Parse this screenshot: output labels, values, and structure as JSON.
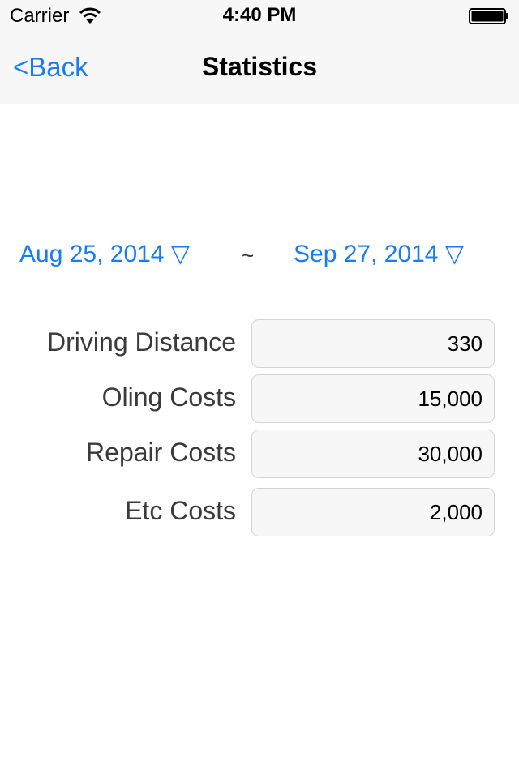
{
  "status_bar": {
    "carrier": "Carrier",
    "time": "4:40 PM",
    "wifi_icon": "wifi-icon",
    "battery_icon": "battery-icon"
  },
  "nav": {
    "back_label": "<Back",
    "title": "Statistics"
  },
  "date_range": {
    "start": "Aug 25, 2014 ▽",
    "separator": "~",
    "end": "Sep 27, 2014 ▽"
  },
  "stats": {
    "driving_distance": {
      "label": "Driving Distance",
      "value": "330"
    },
    "oiling_costs": {
      "label": "Oling Costs",
      "value": "15,000"
    },
    "repair_costs": {
      "label": "Repair Costs",
      "value": "30,000"
    },
    "etc_costs": {
      "label": "Etc Costs",
      "value": "2,000"
    }
  },
  "colors": {
    "accent": "#1a7cf0",
    "bar_background": "#f7f7f7"
  }
}
